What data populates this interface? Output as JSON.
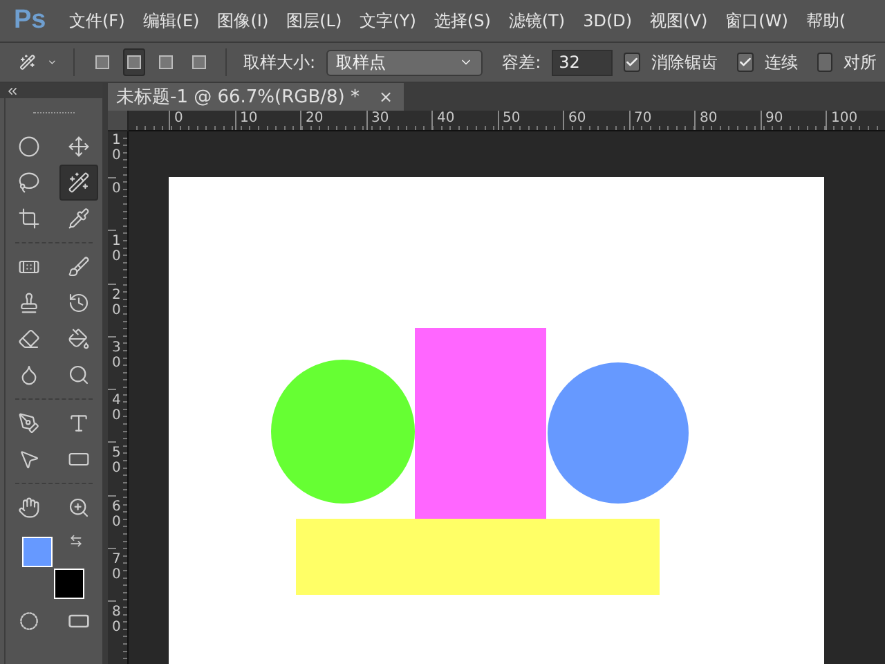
{
  "app": {
    "logo": "Ps"
  },
  "menu": [
    "文件(F)",
    "编辑(E)",
    "图像(I)",
    "图层(L)",
    "文字(Y)",
    "选择(S)",
    "滤镜(T)",
    "3D(D)",
    "视图(V)",
    "窗口(W)",
    "帮助("
  ],
  "options_bar": {
    "selection_modes": [
      {
        "selected": false
      },
      {
        "selected": true
      },
      {
        "selected": false
      },
      {
        "selected": false
      }
    ],
    "sample_size_label": "取样大小:",
    "sample_size": "取样点",
    "tolerance_label": "容差:",
    "tolerance": "32",
    "checkboxes": [
      {
        "label": "消除锯齿",
        "checked": true
      },
      {
        "label": "连续",
        "checked": true
      },
      {
        "label": "对所",
        "checked": false
      }
    ]
  },
  "tools": [
    {
      "selected": false
    },
    {
      "selected": false
    },
    {
      "selected": false
    },
    {
      "selected": true
    },
    {
      "selected": false
    },
    {
      "selected": false
    },
    {
      "selected": false
    },
    {
      "selected": false
    },
    {
      "selected": false
    },
    {
      "selected": false
    },
    {
      "selected": false
    },
    {
      "selected": false
    },
    {
      "selected": false
    },
    {
      "selected": false
    },
    {
      "selected": false
    },
    {
      "selected": false
    },
    {
      "selected": false
    },
    {
      "selected": false
    },
    {
      "selected": false
    },
    {
      "selected": false
    }
  ],
  "color_swatches": [
    {
      "color": "#6699ff"
    },
    {
      "color": "#000000"
    }
  ],
  "document_tab": {
    "title": "未标题-1 @ 66.7%(RGB/8) *",
    "close": "×"
  },
  "horizontal_ruler": [
    "0",
    "10",
    "20",
    "30",
    "40",
    "50",
    "60",
    "70",
    "80",
    "90",
    "100"
  ],
  "vertical_ruler": [
    "10",
    "0",
    "10",
    "20",
    "30",
    "40",
    "50",
    "60",
    "70",
    "80"
  ],
  "canvas": {
    "shapes": [
      {
        "kind": "circle",
        "color": "#66ff33"
      },
      {
        "kind": "rect",
        "color": "#ff66ff"
      },
      {
        "kind": "circle",
        "color": "#6699ff"
      },
      {
        "kind": "rect",
        "color": "#ffff66"
      }
    ]
  }
}
